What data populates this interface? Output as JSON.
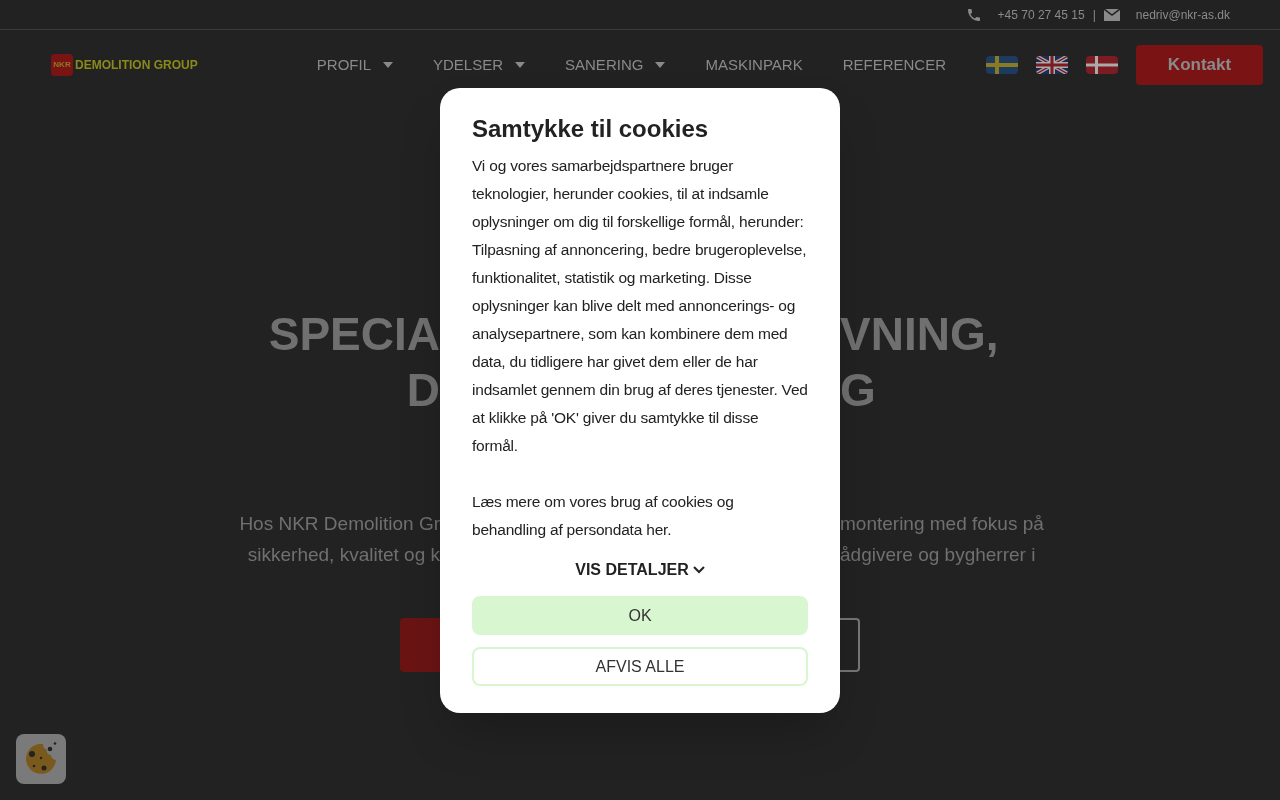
{
  "top_bar": {
    "phone": "+45 70 27 45 15",
    "separator": "|",
    "email": "nedriv@nkr-as.dk"
  },
  "header": {
    "logo": {
      "mark": "NKR",
      "text": "DEMOLITION GROUP"
    },
    "nav": [
      {
        "label": "PROFIL",
        "dropdown": true
      },
      {
        "label": "YDELSER",
        "dropdown": true
      },
      {
        "label": "SANERING",
        "dropdown": true
      },
      {
        "label": "MASKINPARK",
        "dropdown": false
      },
      {
        "label": "REFERENCER",
        "dropdown": false
      }
    ],
    "flags": [
      {
        "kind": "sweden"
      },
      {
        "kind": "uk"
      },
      {
        "kind": "denmark"
      }
    ],
    "cta": "Kontakt"
  },
  "hero": {
    "heading_lines": [
      {
        "left": "SPECIA",
        "right": "VNING,"
      },
      {
        "left": "D",
        "right": "G"
      }
    ],
    "text_lines": [
      {
        "left": "Hos NKR Demolition Gr",
        "right": "montering med fokus på"
      },
      {
        "left": "sikkerhed, kvalitet og k",
        "right": "ådgivere og bygherrer i"
      }
    ]
  },
  "cookie_dialog": {
    "title": "Samtykke til cookies",
    "paragraphs": [
      "Vi og vores samarbejdspartnere bruger teknologier, herunder cookies, til at indsamle oplysninger om dig til forskellige formål, herunder: Tilpasning af annoncering, bedre brugeroplevelse, funktionalitet, statistik og marketing. Disse oplysninger kan blive delt med annoncerings- og analysepartnere, som kan kombinere dem med data, du tidligere har givet dem eller de har indsamlet gennem din brug af deres tjenester. Ved at klikke på 'OK' giver du samtykke til disse formål.",
      "Læs mere om vores brug af cookies og behandling af persondata her."
    ],
    "details_toggle": "VIS DETALJER",
    "buttons": [
      {
        "label": "OK",
        "kind": "primary"
      },
      {
        "label": "AFVIS ALLE",
        "kind": "outline"
      }
    ]
  }
}
